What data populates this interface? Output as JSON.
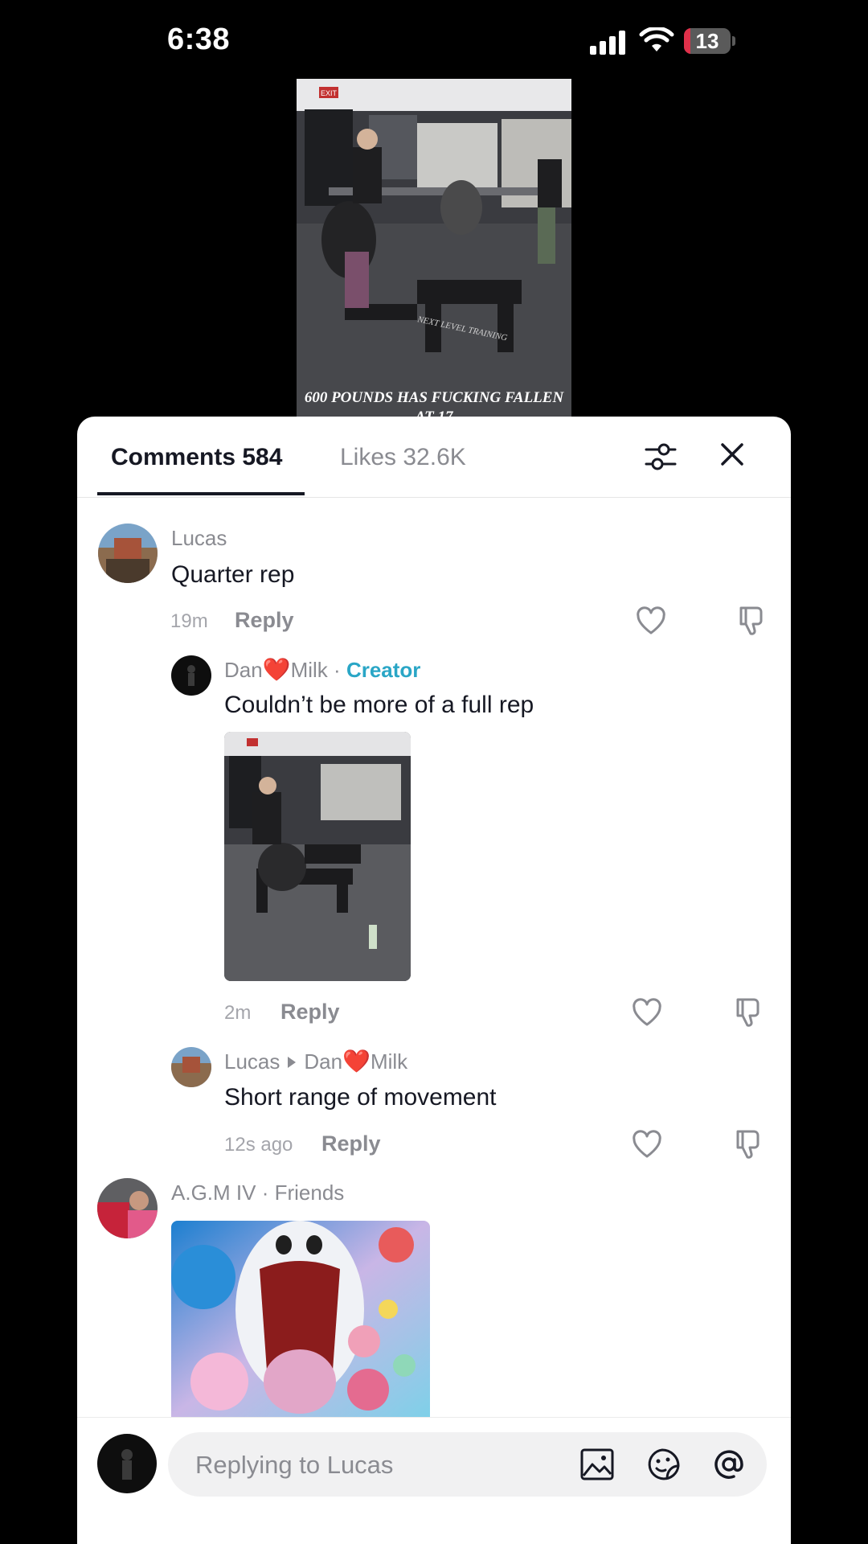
{
  "status_bar": {
    "time": "6:38",
    "battery": "13"
  },
  "video": {
    "caption": "600 POUNDS HAS FUCKING FALLEN AT 17",
    "exit_sign": "EXIT",
    "bench_text": "NEXT LEVEL TRAINING"
  },
  "sheet": {
    "tabs": {
      "comments": "Comments 584",
      "likes": "Likes 32.6K"
    }
  },
  "comments": [
    {
      "user": "Lucas",
      "text": "Quarter rep",
      "time": "19m",
      "reply": "Reply"
    },
    {
      "user_a": "Dan",
      "user_b": "Milk",
      "sep": "·",
      "badge": "Creator",
      "text": "Couldn’t be more of a full rep",
      "time": "2m",
      "reply": "Reply"
    },
    {
      "user": "Lucas",
      "to_a": "Dan",
      "to_b": "Milk",
      "text": "Short range of movement",
      "time": "12s ago",
      "reply": "Reply"
    },
    {
      "user": "A.G.M IV",
      "sep": "·",
      "badge": "Friends"
    }
  ],
  "composer": {
    "placeholder": "Replying to Lucas"
  }
}
